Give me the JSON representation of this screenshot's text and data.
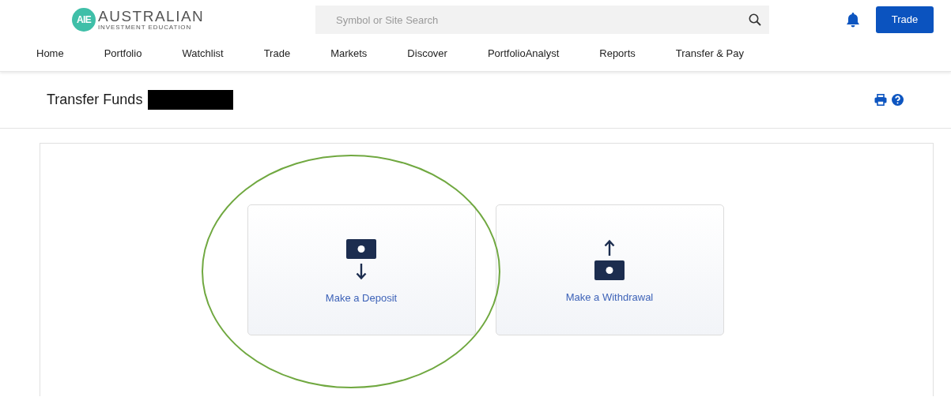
{
  "logo": {
    "mark": "AIE",
    "name": "AUSTRALIAN",
    "tagline": "INVESTMENT EDUCATION"
  },
  "search": {
    "placeholder": "Symbol or Site Search"
  },
  "trade_button": "Trade",
  "nav": [
    {
      "label": "Home"
    },
    {
      "label": "Portfolio"
    },
    {
      "label": "Watchlist"
    },
    {
      "label": "Trade"
    },
    {
      "label": "Markets"
    },
    {
      "label": "Discover"
    },
    {
      "label": "PortfolioAnalyst"
    },
    {
      "label": "Reports"
    },
    {
      "label": "Transfer & Pay"
    }
  ],
  "page_title": "Transfer Funds",
  "options": [
    {
      "kind": "deposit",
      "label": "Make a Deposit"
    },
    {
      "kind": "withdrawal",
      "label": "Make a Withdrawal"
    }
  ]
}
